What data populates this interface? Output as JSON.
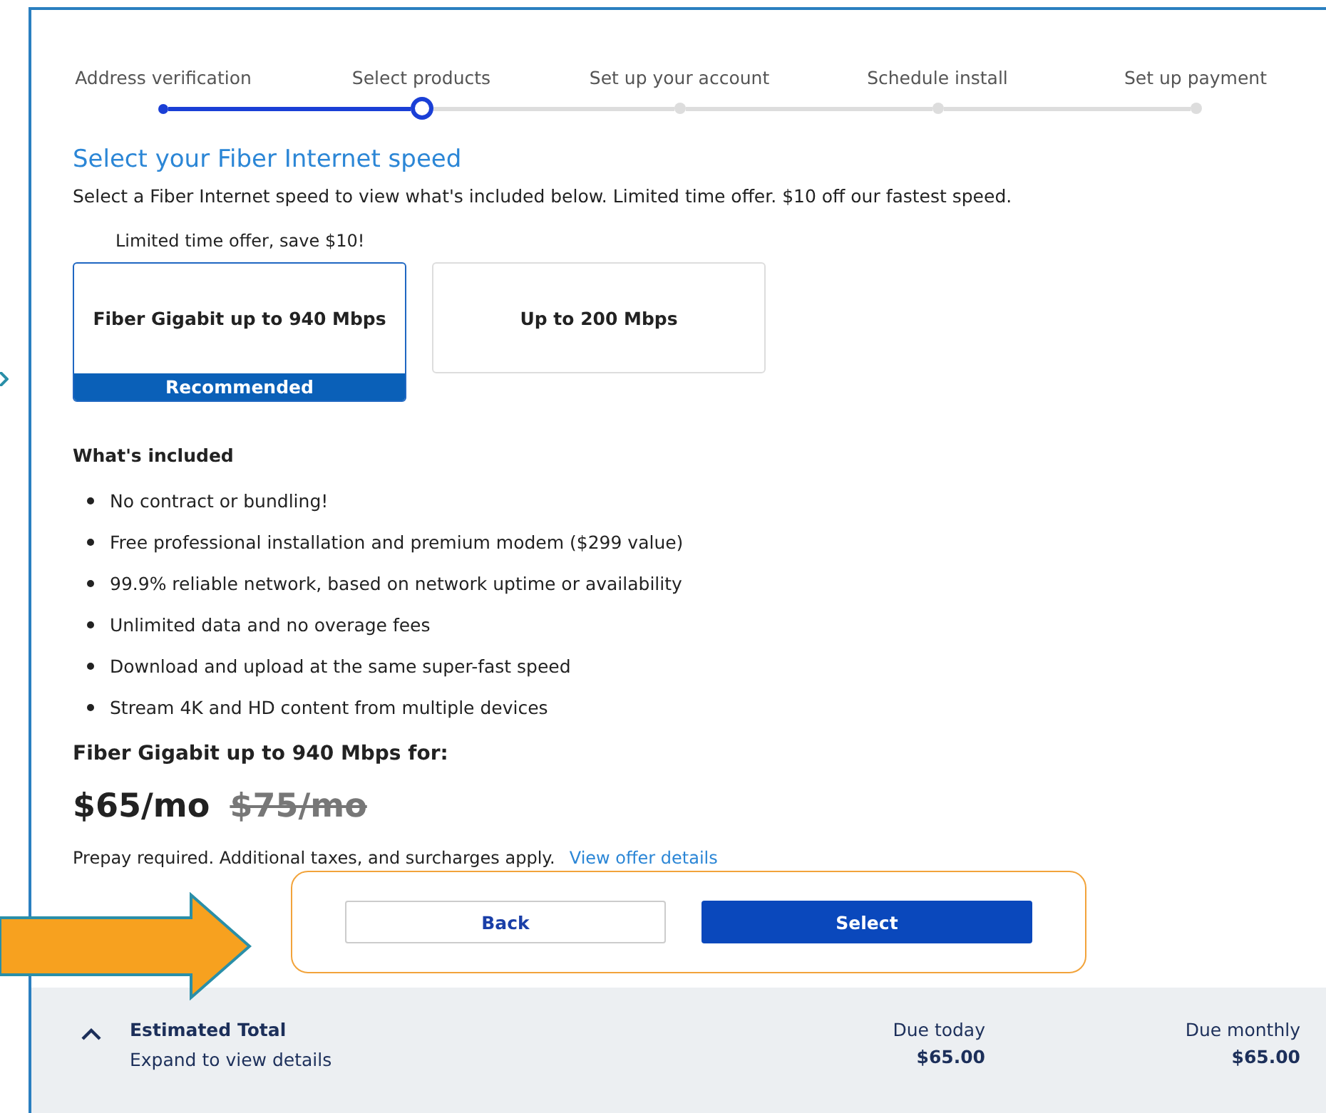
{
  "steps": [
    {
      "label": "Address verification",
      "completed": true,
      "selected": false
    },
    {
      "label": "Select products",
      "completed": false,
      "selected": true
    },
    {
      "label": "Set up your account",
      "completed": false,
      "selected": false
    },
    {
      "label": "Schedule install",
      "completed": false,
      "selected": false
    },
    {
      "label": "Set up payment",
      "completed": false,
      "selected": false
    }
  ],
  "heading": "Select your Fiber Internet speed",
  "intro": "Select a Fiber Internet speed to view what's included below. Limited time offer. $10 off our fastest speed.",
  "offer_note": "Limited time offer, save $10!",
  "plans": [
    {
      "label": "Fiber Gigabit up to 940 Mbps",
      "selected": true,
      "badge": "Recommended"
    },
    {
      "label": "Up to 200 Mbps",
      "selected": false
    }
  ],
  "included": {
    "title": "What's included",
    "items": [
      "No contract or bundling!",
      "Free professional installation and premium modem ($299 value)",
      "99.9% reliable network, based on network uptime or availability",
      "Unlimited data and no overage fees",
      "Download and upload at the same super-fast speed",
      "Stream 4K and HD content from multiple devices"
    ]
  },
  "price": {
    "title": "Fiber Gigabit up to 940 Mbps for:",
    "current": "$65/mo",
    "old": "$75/mo",
    "note": "Prepay required. Additional taxes, and surcharges apply.",
    "link": "View offer details"
  },
  "buttons": {
    "back": "Back",
    "select": "Select"
  },
  "footer": {
    "title": "Estimated Total",
    "subtitle": "Expand to view details",
    "due_today_label": "Due today",
    "due_today": "$65.00",
    "due_monthly_label": "Due monthly",
    "due_monthly": "$65.00"
  }
}
